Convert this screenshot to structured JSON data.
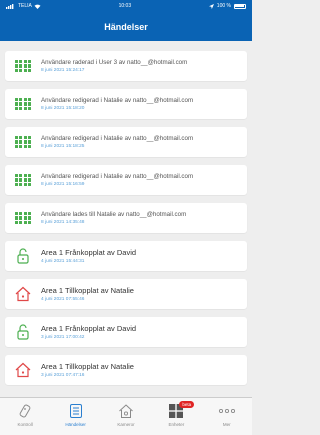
{
  "status_bar": {
    "carrier": "TELIA",
    "time": "10:03",
    "battery": "100 %"
  },
  "header": {
    "title": "Händelser"
  },
  "events": [
    {
      "icon": "users-grid-icon",
      "title": "Användare raderad i User 3 av natto__@hotmail.com",
      "time": "8 juni 2021 15:24:17"
    },
    {
      "icon": "users-grid-icon",
      "title": "Användare redigerad i Natalie av natto__@hotmail.com",
      "time": "8 juni 2021 15:18:20"
    },
    {
      "icon": "users-grid-icon",
      "title": "Användare redigerad i Natalie av natto__@hotmail.com",
      "time": "8 juni 2021 15:18:25"
    },
    {
      "icon": "users-grid-icon",
      "title": "Användare redigerad i Natalie av natto__@hotmail.com",
      "time": "8 juni 2021 15:16:59"
    },
    {
      "icon": "users-grid-icon",
      "title": "Användare lades till Natalie av natto__@hotmail.com",
      "time": "8 juni 2021 14:35:48"
    },
    {
      "icon": "unlock-icon",
      "title": "Area 1 Frånkopplat av David",
      "time": "4 juni 2021 15:44:31"
    },
    {
      "icon": "house-alarm-icon",
      "title": "Area 1 Tillkopplat av Natalie",
      "time": "4 juni 2021 07:55:46"
    },
    {
      "icon": "unlock-icon",
      "title": "Area 1 Frånkopplat av David",
      "time": "3 juni 2021 17:00:42"
    },
    {
      "icon": "house-alarm-icon",
      "title": "Area 1 Tillkopplat av Natalie",
      "time": "3 juni 2021 07:47:16"
    }
  ],
  "tabs": [
    {
      "label": "Kontroll",
      "icon": "remote-icon"
    },
    {
      "label": "Händelser",
      "icon": "list-icon"
    },
    {
      "label": "Kameror",
      "icon": "camera-house-icon"
    },
    {
      "label": "Enheter",
      "icon": "devices-icon",
      "badge": "beta"
    },
    {
      "label": "Mer",
      "icon": "more-icon"
    }
  ],
  "colors": {
    "header": "#0a63b4",
    "green": "#4caf50",
    "red": "#e04848",
    "active_tab": "#2a7fd0"
  }
}
